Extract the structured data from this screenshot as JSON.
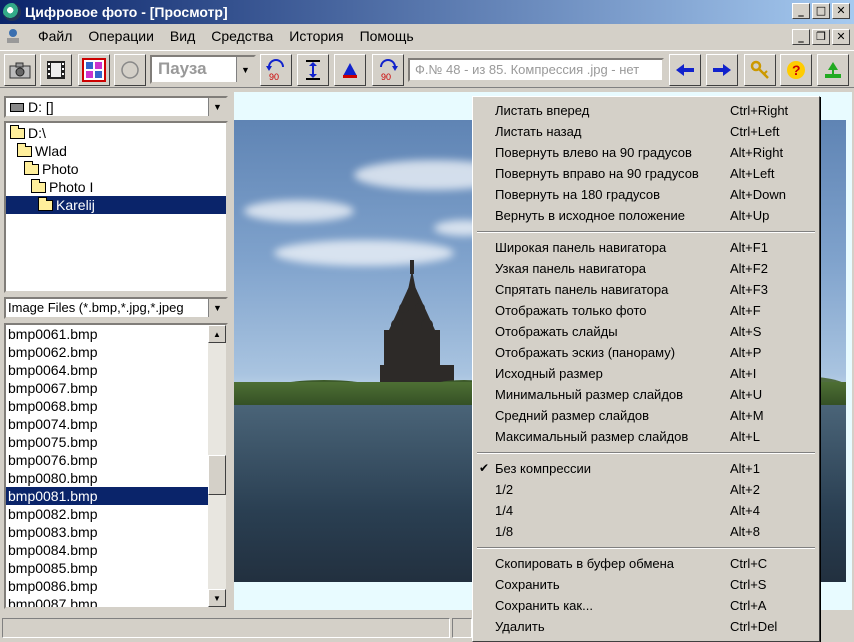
{
  "window": {
    "title": "Цифровое фото - [Просмотр]"
  },
  "menu": [
    "Файл",
    "Операции",
    "Вид",
    "Средства",
    "История",
    "Помощь"
  ],
  "toolbar": {
    "pause_label": "Пауза",
    "info_text": "Ф.№ 48 - из 85. Компрессия .jpg - нет",
    "rotate_left_label": "90",
    "rotate_right_label": "90"
  },
  "drive": {
    "value": "D: []"
  },
  "tree": [
    {
      "label": "D:\\",
      "indent": 0
    },
    {
      "label": "Wlad",
      "indent": 1
    },
    {
      "label": "Photo",
      "indent": 2
    },
    {
      "label": "Photo I",
      "indent": 3
    },
    {
      "label": "Karelij",
      "indent": 4,
      "selected": true
    }
  ],
  "filter": {
    "value": "Image Files (*.bmp,*.jpg,*.jpeg"
  },
  "files": [
    "bmp0061.bmp",
    "bmp0062.bmp",
    "bmp0064.bmp",
    "bmp0067.bmp",
    "bmp0068.bmp",
    "bmp0074.bmp",
    "bmp0075.bmp",
    "bmp0076.bmp",
    "bmp0080.bmp",
    "bmp0081.bmp",
    "bmp0082.bmp",
    "bmp0083.bmp",
    "bmp0084.bmp",
    "bmp0085.bmp",
    "bmp0086.bmp",
    "bmp0087.bmp"
  ],
  "selected_file": "bmp0081.bmp",
  "context_menu": [
    {
      "label": "Листать вперед",
      "key": "Ctrl+Right"
    },
    {
      "label": "Листать назад",
      "key": "Ctrl+Left"
    },
    {
      "label": "Повернуть влево на  90 градусов",
      "key": "Alt+Right"
    },
    {
      "label": "Повернуть вправо на 90  градусов",
      "key": "Alt+Left"
    },
    {
      "label": "Повернуть на 180 градусов",
      "key": "Alt+Down"
    },
    {
      "label": "Вернуть в исходное положение",
      "key": "Alt+Up"
    },
    {
      "separator": true
    },
    {
      "label": "Широкая панель навигатора",
      "key": "Alt+F1"
    },
    {
      "label": "Узкая панель навигатора",
      "key": "Alt+F2"
    },
    {
      "label": "Спрятать панель навигатора",
      "key": "Alt+F3"
    },
    {
      "label": "Отображать только фото",
      "key": "Alt+F"
    },
    {
      "label": "Отображать слайды",
      "key": "Alt+S"
    },
    {
      "label": "Отображать эскиз (панораму)",
      "key": "Alt+P"
    },
    {
      "label": "Исходный размер",
      "key": "Alt+I"
    },
    {
      "label": "Минимальный размер слайдов",
      "key": "Alt+U"
    },
    {
      "label": "Средний размер слайдов",
      "key": "Alt+M"
    },
    {
      "label": "Максимальный размер слайдов",
      "key": "Alt+L"
    },
    {
      "separator": true
    },
    {
      "label": "Без компрессии",
      "key": "Alt+1",
      "checked": true
    },
    {
      "label": "1/2",
      "key": "Alt+2"
    },
    {
      "label": "1/4",
      "key": "Alt+4"
    },
    {
      "label": "1/8",
      "key": "Alt+8"
    },
    {
      "separator": true
    },
    {
      "label": "Скопировать в буфер обмена",
      "key": "Ctrl+C"
    },
    {
      "label": "Сохранить",
      "key": "Ctrl+S"
    },
    {
      "label": "Сохранить  как...",
      "key": "Ctrl+A"
    },
    {
      "label": "Удалить",
      "key": "Ctrl+Del"
    }
  ],
  "colors": {
    "titlebar": "#0a246a",
    "selection": "#0a246a",
    "face": "#d4d0c8"
  },
  "window_controls": {
    "minimize": "_",
    "maximize": "□",
    "close": "✕",
    "restore": "❐"
  }
}
